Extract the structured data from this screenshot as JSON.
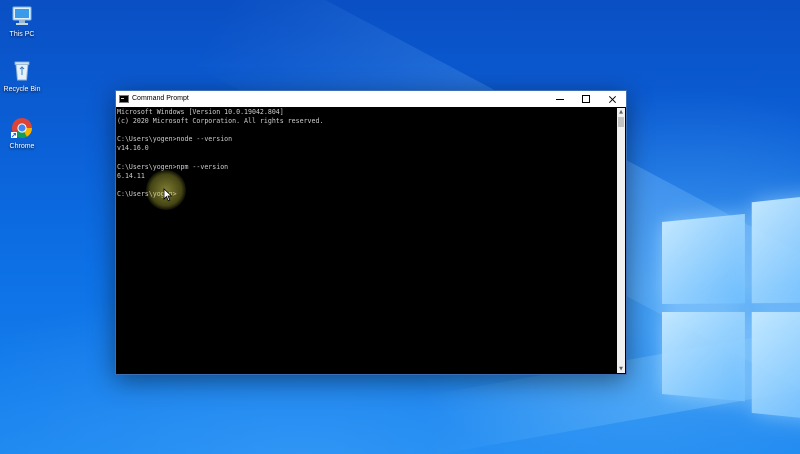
{
  "desktop": {
    "icons": [
      {
        "label": "This PC",
        "icon": "this-pc-icon"
      },
      {
        "label": "Recycle Bin",
        "icon": "recycle-bin-icon"
      },
      {
        "label": "Chrome",
        "icon": "chrome-icon"
      }
    ],
    "colors": {
      "wallpaper": "#0b5fd6",
      "accent": "#1a86f0"
    }
  },
  "cmd_window": {
    "title": "Command Prompt",
    "controls": {
      "minimize": "minimize-icon",
      "maximize": "maximize-icon",
      "close": "close-icon"
    },
    "console_lines": [
      "Microsoft Windows [Version 10.0.19042.804]",
      "(c) 2020 Microsoft Corporation. All rights reserved.",
      "",
      "C:\\Users\\yogen>node --version",
      "v14.16.0",
      "",
      "C:\\Users\\yogen>npm --version",
      "6.14.11",
      "",
      "C:\\Users\\yogen>"
    ],
    "colors": {
      "console_bg": "#000000",
      "console_text": "#cccccc",
      "titlebar": "#ffffff"
    }
  }
}
